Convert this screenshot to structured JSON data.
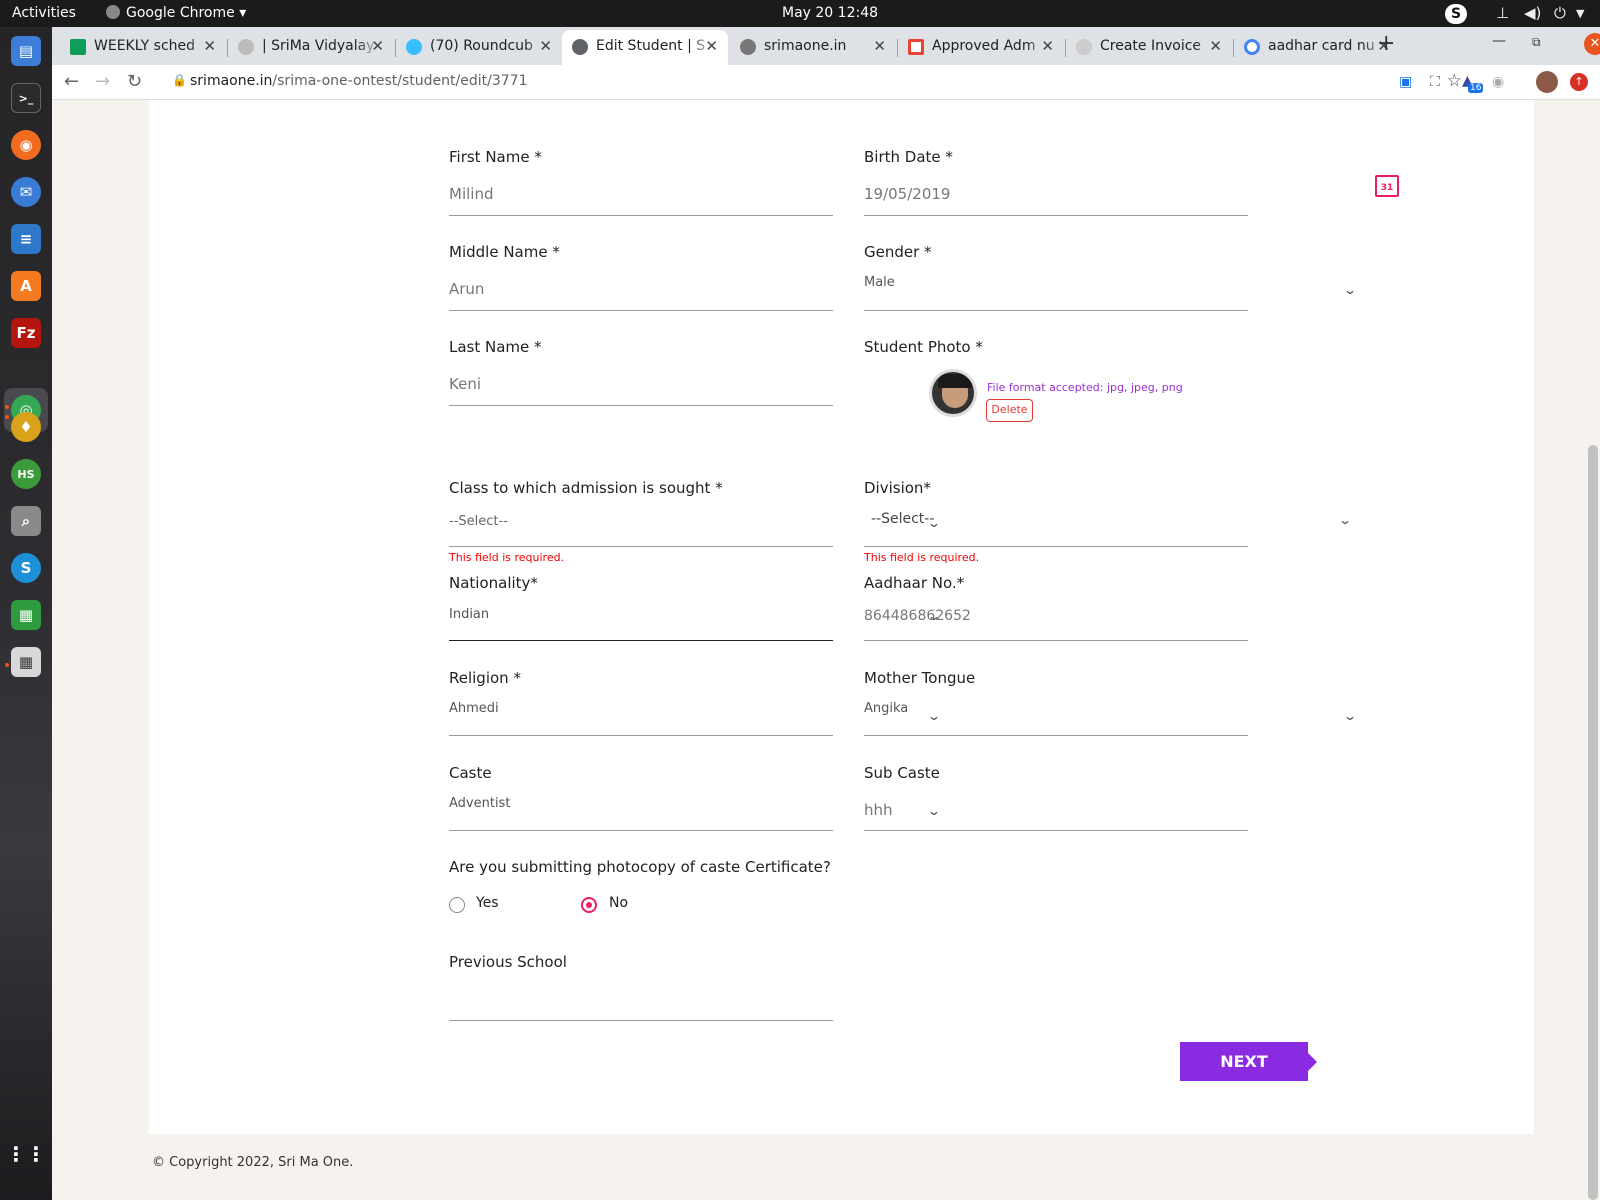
{
  "system": {
    "activities": "Activities",
    "app_menu": "Google Chrome",
    "clock": "May 20  12:48"
  },
  "browser": {
    "tabs": [
      {
        "title": "WEEKLY sched",
        "favicon": "sheets-icon"
      },
      {
        "title": "| SriMa Vidyalay",
        "favicon": "globe-icon"
      },
      {
        "title": "(70) Roundcub",
        "favicon": "roundcube-icon"
      },
      {
        "title": "Edit Student | S",
        "favicon": "globe-icon"
      },
      {
        "title": "srimaone.in",
        "favicon": "globe-icon"
      },
      {
        "title": "Approved Adm",
        "favicon": "gmail-icon"
      },
      {
        "title": "Create Invoice",
        "favicon": "globe-icon"
      },
      {
        "title": "aadhar card nu",
        "favicon": "google-icon"
      }
    ],
    "url_domain": "srimaone.in",
    "url_path": "/srima-one-ontest/student/edit/3771",
    "extension_badge": "16"
  },
  "form": {
    "first_name": {
      "label": "First Name *",
      "value": "Milind"
    },
    "birth_date": {
      "label": "Birth Date *",
      "value": "19/05/2019",
      "calendar_day": "31"
    },
    "middle_name": {
      "label": "Middle Name *",
      "value": "Arun"
    },
    "gender": {
      "label": "Gender *",
      "value": "Male"
    },
    "last_name": {
      "label": "Last Name *",
      "value": "Keni"
    },
    "student_photo": {
      "label": "Student Photo *",
      "hint": "File format accepted: jpg, jpeg, png",
      "delete_label": "Delete"
    },
    "class": {
      "label": "Class to which admission is sought *",
      "value": "--Select--",
      "error": "This field is required."
    },
    "division": {
      "label": "Division*",
      "value": "--Select--",
      "error": "This field is required."
    },
    "nationality": {
      "label": "Nationality*",
      "value": "Indian"
    },
    "aadhaar": {
      "label": "Aadhaar No.*",
      "value": "864486862652"
    },
    "religion": {
      "label": "Religion *",
      "value": "Ahmedi"
    },
    "mother_tongue": {
      "label": "Mother Tongue",
      "value": "Angika"
    },
    "caste": {
      "label": "Caste",
      "value": "Adventist"
    },
    "sub_caste": {
      "label": "Sub Caste",
      "value": "hhh"
    },
    "caste_certificate": {
      "question": "Are you submitting photocopy of caste Certificate?",
      "yes_label": "Yes",
      "no_label": "No",
      "selected": "No"
    },
    "previous_school": {
      "label": "Previous School",
      "value": ""
    },
    "next_label": "NEXT"
  },
  "footer": {
    "copyright": "© Copyright 2022, Sri Ma One."
  },
  "colors": {
    "accent": "#8a2be2",
    "error": "#e00000",
    "pink": "#e91e63"
  }
}
